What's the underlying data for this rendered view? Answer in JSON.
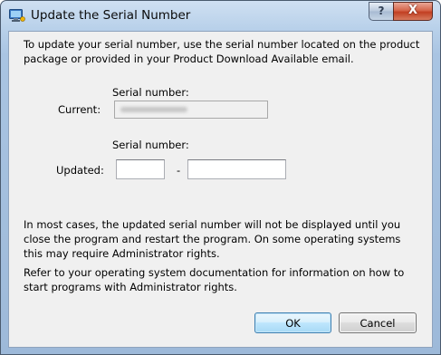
{
  "window": {
    "title": "Update the Serial Number",
    "icon": "app-window-icon",
    "help_glyph": "?",
    "close_glyph": "X"
  },
  "dialog": {
    "intro": "To update your serial number, use the serial number located on the product package or provided in your Product Download Available email.",
    "current": {
      "heading": "Serial number:",
      "label": "Current:",
      "value_obscured": true
    },
    "updated": {
      "heading": "Serial number:",
      "label": "Updated:",
      "part1_value": "",
      "separator": "-",
      "part2_value": ""
    },
    "note1": "In most cases, the updated serial number will not be displayed until you close the program and restart the program. On some operating systems this may require Administrator rights.",
    "note2": "Refer to your operating system documentation for information on how to start programs with Administrator rights.",
    "buttons": {
      "ok": "OK",
      "cancel": "Cancel"
    }
  },
  "colors": {
    "client_bg": "#f0f0f0",
    "frame": "#a9c4e2",
    "ok_border": "#3c7fb1",
    "close_button": "#c13f22"
  }
}
